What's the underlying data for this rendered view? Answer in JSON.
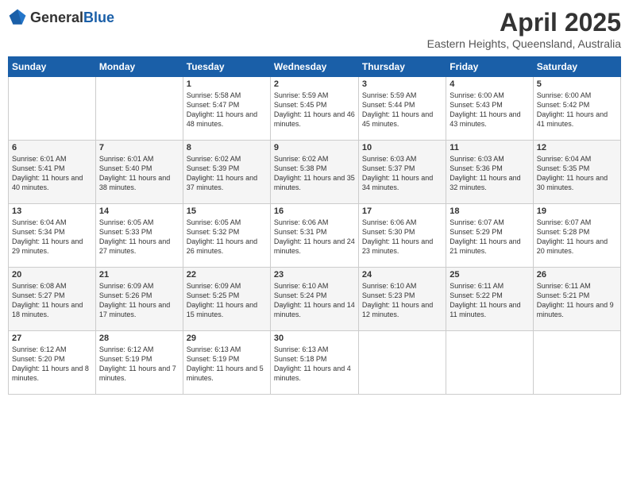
{
  "header": {
    "logo_general": "General",
    "logo_blue": "Blue",
    "month": "April 2025",
    "location": "Eastern Heights, Queensland, Australia"
  },
  "weekdays": [
    "Sunday",
    "Monday",
    "Tuesday",
    "Wednesday",
    "Thursday",
    "Friday",
    "Saturday"
  ],
  "weeks": [
    [
      {
        "day": "",
        "empty": true
      },
      {
        "day": "",
        "empty": true
      },
      {
        "day": "1",
        "sunrise": "Sunrise: 5:58 AM",
        "sunset": "Sunset: 5:47 PM",
        "daylight": "Daylight: 11 hours and 48 minutes."
      },
      {
        "day": "2",
        "sunrise": "Sunrise: 5:59 AM",
        "sunset": "Sunset: 5:45 PM",
        "daylight": "Daylight: 11 hours and 46 minutes."
      },
      {
        "day": "3",
        "sunrise": "Sunrise: 5:59 AM",
        "sunset": "Sunset: 5:44 PM",
        "daylight": "Daylight: 11 hours and 45 minutes."
      },
      {
        "day": "4",
        "sunrise": "Sunrise: 6:00 AM",
        "sunset": "Sunset: 5:43 PM",
        "daylight": "Daylight: 11 hours and 43 minutes."
      },
      {
        "day": "5",
        "sunrise": "Sunrise: 6:00 AM",
        "sunset": "Sunset: 5:42 PM",
        "daylight": "Daylight: 11 hours and 41 minutes."
      }
    ],
    [
      {
        "day": "6",
        "sunrise": "Sunrise: 6:01 AM",
        "sunset": "Sunset: 5:41 PM",
        "daylight": "Daylight: 11 hours and 40 minutes."
      },
      {
        "day": "7",
        "sunrise": "Sunrise: 6:01 AM",
        "sunset": "Sunset: 5:40 PM",
        "daylight": "Daylight: 11 hours and 38 minutes."
      },
      {
        "day": "8",
        "sunrise": "Sunrise: 6:02 AM",
        "sunset": "Sunset: 5:39 PM",
        "daylight": "Daylight: 11 hours and 37 minutes."
      },
      {
        "day": "9",
        "sunrise": "Sunrise: 6:02 AM",
        "sunset": "Sunset: 5:38 PM",
        "daylight": "Daylight: 11 hours and 35 minutes."
      },
      {
        "day": "10",
        "sunrise": "Sunrise: 6:03 AM",
        "sunset": "Sunset: 5:37 PM",
        "daylight": "Daylight: 11 hours and 34 minutes."
      },
      {
        "day": "11",
        "sunrise": "Sunrise: 6:03 AM",
        "sunset": "Sunset: 5:36 PM",
        "daylight": "Daylight: 11 hours and 32 minutes."
      },
      {
        "day": "12",
        "sunrise": "Sunrise: 6:04 AM",
        "sunset": "Sunset: 5:35 PM",
        "daylight": "Daylight: 11 hours and 30 minutes."
      }
    ],
    [
      {
        "day": "13",
        "sunrise": "Sunrise: 6:04 AM",
        "sunset": "Sunset: 5:34 PM",
        "daylight": "Daylight: 11 hours and 29 minutes."
      },
      {
        "day": "14",
        "sunrise": "Sunrise: 6:05 AM",
        "sunset": "Sunset: 5:33 PM",
        "daylight": "Daylight: 11 hours and 27 minutes."
      },
      {
        "day": "15",
        "sunrise": "Sunrise: 6:05 AM",
        "sunset": "Sunset: 5:32 PM",
        "daylight": "Daylight: 11 hours and 26 minutes."
      },
      {
        "day": "16",
        "sunrise": "Sunrise: 6:06 AM",
        "sunset": "Sunset: 5:31 PM",
        "daylight": "Daylight: 11 hours and 24 minutes."
      },
      {
        "day": "17",
        "sunrise": "Sunrise: 6:06 AM",
        "sunset": "Sunset: 5:30 PM",
        "daylight": "Daylight: 11 hours and 23 minutes."
      },
      {
        "day": "18",
        "sunrise": "Sunrise: 6:07 AM",
        "sunset": "Sunset: 5:29 PM",
        "daylight": "Daylight: 11 hours and 21 minutes."
      },
      {
        "day": "19",
        "sunrise": "Sunrise: 6:07 AM",
        "sunset": "Sunset: 5:28 PM",
        "daylight": "Daylight: 11 hours and 20 minutes."
      }
    ],
    [
      {
        "day": "20",
        "sunrise": "Sunrise: 6:08 AM",
        "sunset": "Sunset: 5:27 PM",
        "daylight": "Daylight: 11 hours and 18 minutes."
      },
      {
        "day": "21",
        "sunrise": "Sunrise: 6:09 AM",
        "sunset": "Sunset: 5:26 PM",
        "daylight": "Daylight: 11 hours and 17 minutes."
      },
      {
        "day": "22",
        "sunrise": "Sunrise: 6:09 AM",
        "sunset": "Sunset: 5:25 PM",
        "daylight": "Daylight: 11 hours and 15 minutes."
      },
      {
        "day": "23",
        "sunrise": "Sunrise: 6:10 AM",
        "sunset": "Sunset: 5:24 PM",
        "daylight": "Daylight: 11 hours and 14 minutes."
      },
      {
        "day": "24",
        "sunrise": "Sunrise: 6:10 AM",
        "sunset": "Sunset: 5:23 PM",
        "daylight": "Daylight: 11 hours and 12 minutes."
      },
      {
        "day": "25",
        "sunrise": "Sunrise: 6:11 AM",
        "sunset": "Sunset: 5:22 PM",
        "daylight": "Daylight: 11 hours and 11 minutes."
      },
      {
        "day": "26",
        "sunrise": "Sunrise: 6:11 AM",
        "sunset": "Sunset: 5:21 PM",
        "daylight": "Daylight: 11 hours and 9 minutes."
      }
    ],
    [
      {
        "day": "27",
        "sunrise": "Sunrise: 6:12 AM",
        "sunset": "Sunset: 5:20 PM",
        "daylight": "Daylight: 11 hours and 8 minutes."
      },
      {
        "day": "28",
        "sunrise": "Sunrise: 6:12 AM",
        "sunset": "Sunset: 5:19 PM",
        "daylight": "Daylight: 11 hours and 7 minutes."
      },
      {
        "day": "29",
        "sunrise": "Sunrise: 6:13 AM",
        "sunset": "Sunset: 5:19 PM",
        "daylight": "Daylight: 11 hours and 5 minutes."
      },
      {
        "day": "30",
        "sunrise": "Sunrise: 6:13 AM",
        "sunset": "Sunset: 5:18 PM",
        "daylight": "Daylight: 11 hours and 4 minutes."
      },
      {
        "day": "",
        "empty": true
      },
      {
        "day": "",
        "empty": true
      },
      {
        "day": "",
        "empty": true
      }
    ]
  ]
}
